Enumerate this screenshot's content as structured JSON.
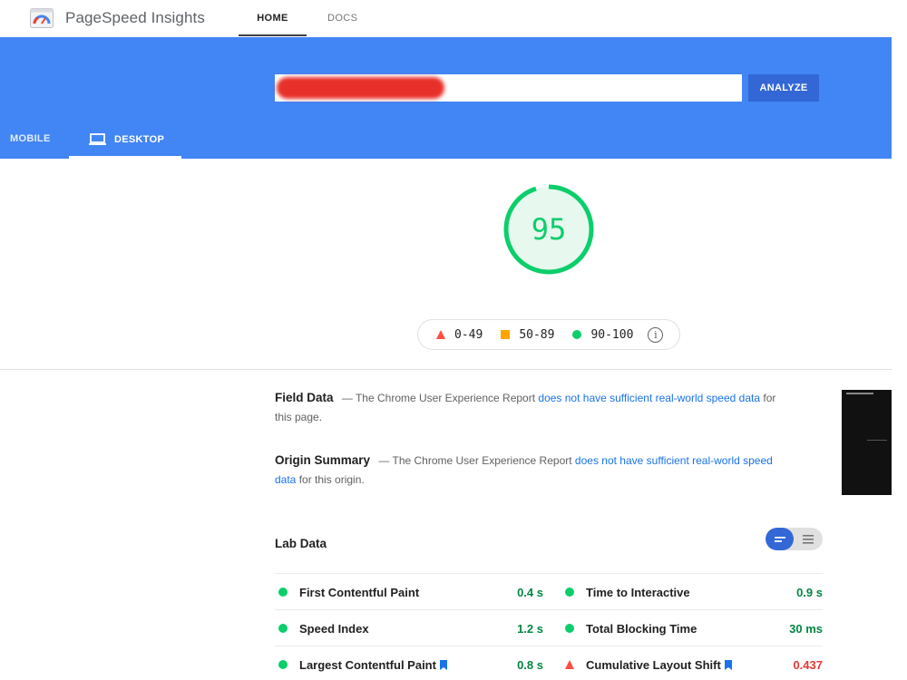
{
  "header": {
    "brand": "PageSpeed Insights",
    "tabs": {
      "home": "HOME",
      "docs": "DOCS"
    }
  },
  "banner": {
    "url_value": "",
    "analyze_label": "ANALYZE",
    "device_tabs": {
      "mobile": "MOBILE",
      "desktop": "DESKTOP"
    },
    "active_device": "desktop"
  },
  "score": {
    "value": "95",
    "fraction": 0.95,
    "color": "#0cce6b"
  },
  "legend": {
    "poor": "0-49",
    "average": "50-89",
    "good": "90-100"
  },
  "field_data": {
    "title": "Field Data",
    "prefix": "— The Chrome User Experience Report",
    "link": "does not have sufficient real-world speed data",
    "suffix": "for this page."
  },
  "origin_summary": {
    "title": "Origin Summary",
    "prefix": "— The Chrome User Experience Report",
    "link": "does not have sufficient real-world speed data",
    "suffix": "for this origin."
  },
  "lab_data": {
    "title": "Lab Data",
    "metrics": [
      {
        "name": "First Contentful Paint",
        "value": "0.4 s",
        "status": "good",
        "bookmark": false
      },
      {
        "name": "Time to Interactive",
        "value": "0.9 s",
        "status": "good",
        "bookmark": false
      },
      {
        "name": "Speed Index",
        "value": "1.2 s",
        "status": "good",
        "bookmark": false
      },
      {
        "name": "Total Blocking Time",
        "value": "30 ms",
        "status": "good",
        "bookmark": false
      },
      {
        "name": "Largest Contentful Paint",
        "value": "0.8 s",
        "status": "good",
        "bookmark": true
      },
      {
        "name": "Cumulative Layout Shift",
        "value": "0.437",
        "status": "poor",
        "bookmark": true
      }
    ]
  },
  "colors": {
    "brand_blue": "#4285f4",
    "button_blue": "#3367d6",
    "good": "#0cce6b",
    "average": "#ffa400",
    "poor": "#ff4e42",
    "link": "#1a73e8"
  }
}
